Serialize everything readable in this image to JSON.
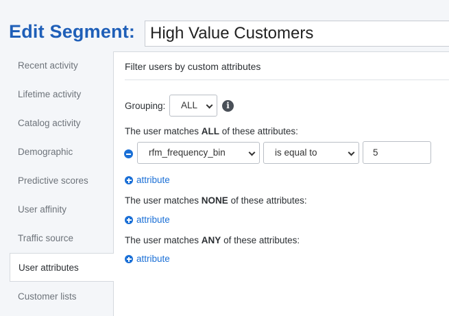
{
  "header": {
    "title": "Edit Segment:",
    "segment_name": "High Value Customers"
  },
  "sidebar": {
    "items": [
      {
        "label": "Recent activity"
      },
      {
        "label": "Lifetime activity"
      },
      {
        "label": "Catalog activity"
      },
      {
        "label": "Demographic"
      },
      {
        "label": "Predictive scores"
      },
      {
        "label": "User affinity"
      },
      {
        "label": "Traffic source"
      },
      {
        "label": "User attributes",
        "active": true
      },
      {
        "label": "Customer lists"
      }
    ]
  },
  "panel": {
    "title": "Filter users by custom attributes",
    "grouping_label": "Grouping:",
    "grouping_value": "ALL",
    "all_section": {
      "prefix": "The user matches ",
      "keyword": "ALL",
      "suffix": " of these attributes:",
      "rule": {
        "attribute": "rfm_frequency_bin",
        "operator": "is equal to",
        "value": "5"
      }
    },
    "none_section": {
      "prefix": "The user matches ",
      "keyword": "NONE",
      "suffix": " of these attributes:"
    },
    "any_section": {
      "prefix": "The user matches ",
      "keyword": "ANY",
      "suffix": " of these attributes:"
    },
    "add_attribute_label": "attribute",
    "info_icon_glyph": "i"
  },
  "colors": {
    "title_blue": "#1f5fb8",
    "link_blue": "#1a6fd6",
    "page_bg": "#f4f6f9"
  },
  "icons": {
    "info": "info-circle-icon",
    "remove": "minus-circle-icon",
    "add": "plus-circle-icon",
    "dropdown": "chevron-down-icon"
  }
}
